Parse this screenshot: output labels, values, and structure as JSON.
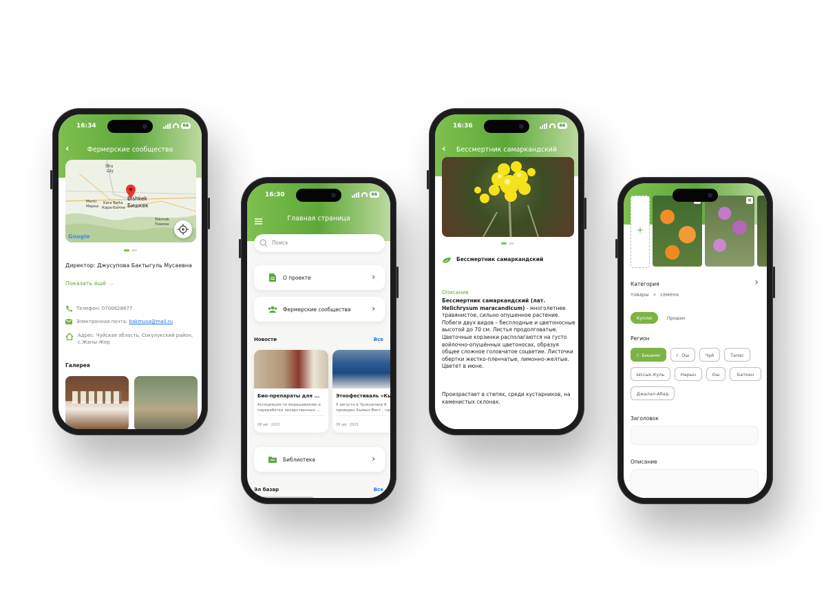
{
  "phone1": {
    "time": "16:34",
    "battery": "66",
    "title": "Фермерские сообщества",
    "map": {
      "labels": [
        "Shu",
        "Шу",
        "Bishkek",
        "Бишкек",
        "Merki",
        "Мерке",
        "Kara Balta",
        "Кара-Балта",
        "Tokmok",
        "Токмок"
      ],
      "google": "Google"
    },
    "director": "Директор: Джусупова Бактыгуль Мусаевна",
    "show_more": "Показать ещё",
    "phone": "Телефон: 0700628677",
    "email_label": "Электронная почта: ",
    "email": "bakmusa@mail.ru",
    "address": "Адрес: Чуйская область, Сокулукский район, с.Жаны-Жер",
    "gallery_title": "Галерея"
  },
  "phone2": {
    "time": "16:30",
    "battery": "66",
    "title": "Главная страница",
    "search_placeholder": "Поиск",
    "menu": [
      "О проекте",
      "Фермерские сообщества"
    ],
    "news_title": "Новости",
    "all": "Все",
    "news": [
      {
        "title": "Био-препараты для ...",
        "text": "Ассоциация по выращиванию и переработке лекарственных ...",
        "date": "08 авг. 2023"
      },
      {
        "title": "Этнофестиваль «Кым",
        "text": "5 августа в Чункурчаке б проведен Кымыз Фест , где",
        "date": "09 авг. 2023"
      }
    ],
    "library": "Библиотека",
    "bazaar_title": "Эл базар",
    "bazaar_all": "Все"
  },
  "phone3": {
    "time": "16:36",
    "battery": "66",
    "title": "Бессмертник самаркандский",
    "plant_name": "Бессмертник самаркандский",
    "description_label": "Описание",
    "desc_bold": "Бессмертник самаркандский (лат. Helichrysum maracandicum)",
    "desc_text": " - многолетнее травянистое, сильно опушенное растение. Побеги двух видов – бесплодные и цветоносные высотой до 70 см. Листья продолговатые. Цветочные корзинки располагаются на густо войлочно-опушённых цветоносах, образуя общее сложное головчатое соцветие. Листочки обертки жестко-пленчатые, лимонно-желтые. Цветет в июне.",
    "desc_habitat": "Произрастает в степях, среди кустарников, на каменистых склонах."
  },
  "phone4": {
    "add_symbol": "+",
    "close_symbol": "×",
    "category_label": "Категория",
    "category_path_1": "товары",
    "category_sep": "»",
    "category_path_2": "семена",
    "deal_types": [
      "Куплю",
      "Продам"
    ],
    "region_label": "Регион",
    "regions": [
      "г. Бишкек",
      "г. Ош",
      "Чуй",
      "Талас",
      "Ыссык-Куль",
      "Нарын",
      "Ош",
      "Баткен",
      "Джалал-Абад"
    ],
    "heading_label": "Заголовок",
    "description_label": "Описание"
  },
  "colors": {
    "primary_green": "#5ea83a",
    "light_green": "#7cbf4a",
    "link_blue": "#1a73e8"
  }
}
